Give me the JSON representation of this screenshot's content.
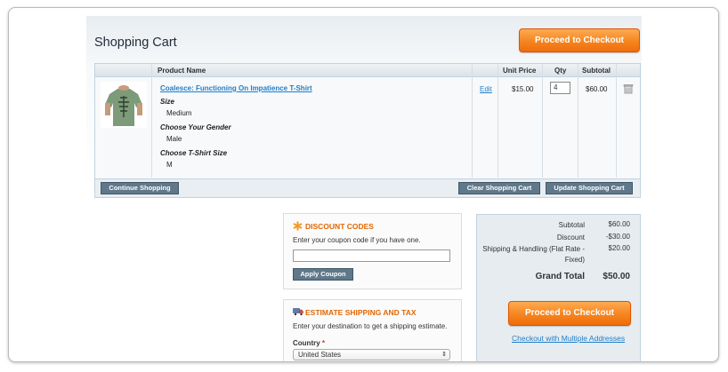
{
  "page": {
    "title": "Shopping Cart",
    "checkout_top_label": "Proceed to Checkout"
  },
  "cart": {
    "headers": {
      "product_name": "Product Name",
      "unit_price": "Unit Price",
      "qty": "Qty",
      "subtotal": "Subtotal"
    },
    "item": {
      "name": "Coalesce: Functioning On Impatience T-Shirt",
      "options": [
        {
          "label": "Size",
          "value": "Medium"
        },
        {
          "label": "Choose Your Gender",
          "value": "Male"
        },
        {
          "label": "Choose T-Shirt Size",
          "value": "M"
        }
      ],
      "edit_label": "Edit",
      "unit_price": "$15.00",
      "qty": "4",
      "subtotal": "$60.00",
      "image_icon": "tshirt-image",
      "remove_icon": "trash-icon"
    },
    "buttons": {
      "continue": "Continue Shopping",
      "clear": "Clear Shopping Cart",
      "update": "Update Shopping Cart"
    }
  },
  "discount": {
    "title": "DISCOUNT CODES",
    "text": "Enter your coupon code if you have one.",
    "input_value": "",
    "apply_label": "Apply Coupon",
    "icon": "asterisk-icon"
  },
  "shipping": {
    "title": "ESTIMATE SHIPPING AND TAX",
    "text": "Enter your destination to get a shipping estimate.",
    "country_label": "Country",
    "required_mark": "*",
    "country_value": "United States",
    "icon": "truck-icon"
  },
  "totals": {
    "subtotal_label": "Subtotal",
    "subtotal_value": "$60.00",
    "discount_label": "Discount",
    "discount_value": "-$30.00",
    "shipping_label_1": "Shipping & Handling (Flat Rate -",
    "shipping_label_2": "Fixed)",
    "shipping_value": "$20.00",
    "grand_label": "Grand Total",
    "grand_value": "$50.00",
    "checkout_label": "Proceed to Checkout",
    "multi_label": "Checkout with Multiple Addresses"
  },
  "colors": {
    "accent_orange": "#f6841f",
    "link_blue": "#1e7ec8",
    "button_gray": "#60788a"
  }
}
